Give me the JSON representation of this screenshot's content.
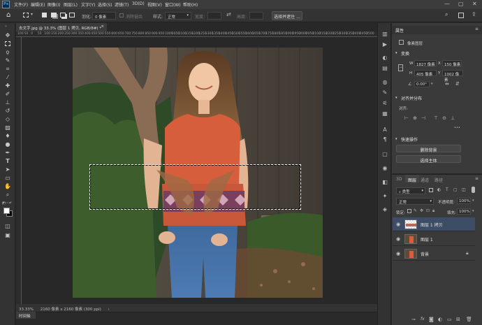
{
  "menu": {
    "items": [
      "文件(F)",
      "编辑(E)",
      "图像(I)",
      "图层(L)",
      "文字(Y)",
      "选择(S)",
      "滤镜(T)",
      "3D(D)",
      "视图(V)",
      "窗口(W)",
      "帮助(H)"
    ]
  },
  "window": {
    "minimize": "—",
    "maximize": "▢",
    "close": "✕"
  },
  "options": {
    "feather_label": "羽化:",
    "feather_value": "0 像素",
    "antialias_label": "消除锯齿",
    "style_label": "样式:",
    "style_value": "正常",
    "width_label": "宽度:",
    "height_label": "高度:",
    "select_subject_label": "选择并遮住 ..."
  },
  "document": {
    "tab_title": "去文字.jpg @ 33.3% (图层 1 拷贝, RGB/8#) *",
    "tab_close": "×",
    "ruler_ticks": [
      "100",
      "50",
      "0",
      "50",
      "100",
      "150",
      "200",
      "250",
      "300",
      "350",
      "400",
      "450",
      "500",
      "550",
      "600",
      "650",
      "700",
      "750",
      "800",
      "850",
      "900",
      "950",
      "1000",
      "1050",
      "1100",
      "1150",
      "1200",
      "1250",
      "1300",
      "1350",
      "1400",
      "1450",
      "1500",
      "1550",
      "1600",
      "1650",
      "1700",
      "1750",
      "1800",
      "1850",
      "1900",
      "1950",
      "2000",
      "2050",
      "2100",
      "2150",
      "2200",
      "2250",
      "2300",
      "2350",
      "2400",
      "2450",
      "2500"
    ]
  },
  "status": {
    "zoom": "33.33%",
    "doc_info": "2160 像素 x 2160 像素 (300 ppi)",
    "arrow": "›"
  },
  "timeline": {
    "tab_label": "时间轴"
  },
  "properties": {
    "panel_title": "属性",
    "layer_type": "像素图层",
    "transform_title": "变换",
    "w_label": "W",
    "w_value": "1827 像素",
    "h_label": "H",
    "h_value": "405 像素",
    "x_label": "X",
    "x_value": "150 像素",
    "y_label": "Y",
    "y_value": "1002 像素",
    "angle_value": "0.00°",
    "align_title": "对齐并分布",
    "align_label": "对齐:",
    "more": "•••",
    "quick_title": "快速操作",
    "remove_bg": "删除背景",
    "select_subject": "选择主体"
  },
  "layers_panel": {
    "tabs": [
      "3D",
      "图层",
      "通道",
      "路径"
    ],
    "active_tab": "图层",
    "filter_label": "类型",
    "blend_mode": "正常",
    "opacity_label": "不透明度:",
    "opacity_value": "100%",
    "lock_label": "锁定:",
    "fill_label": "填充:",
    "fill_value": "100%",
    "layers": [
      {
        "name": "图层 1 拷贝",
        "active": true,
        "locked": false
      },
      {
        "name": "图层 1",
        "active": false,
        "locked": false
      },
      {
        "name": "背景",
        "active": false,
        "locked": true
      }
    ]
  },
  "colors": {
    "accent": "#3d4d66",
    "ui_bg": "#333333",
    "canvas_bg": "#282828"
  }
}
